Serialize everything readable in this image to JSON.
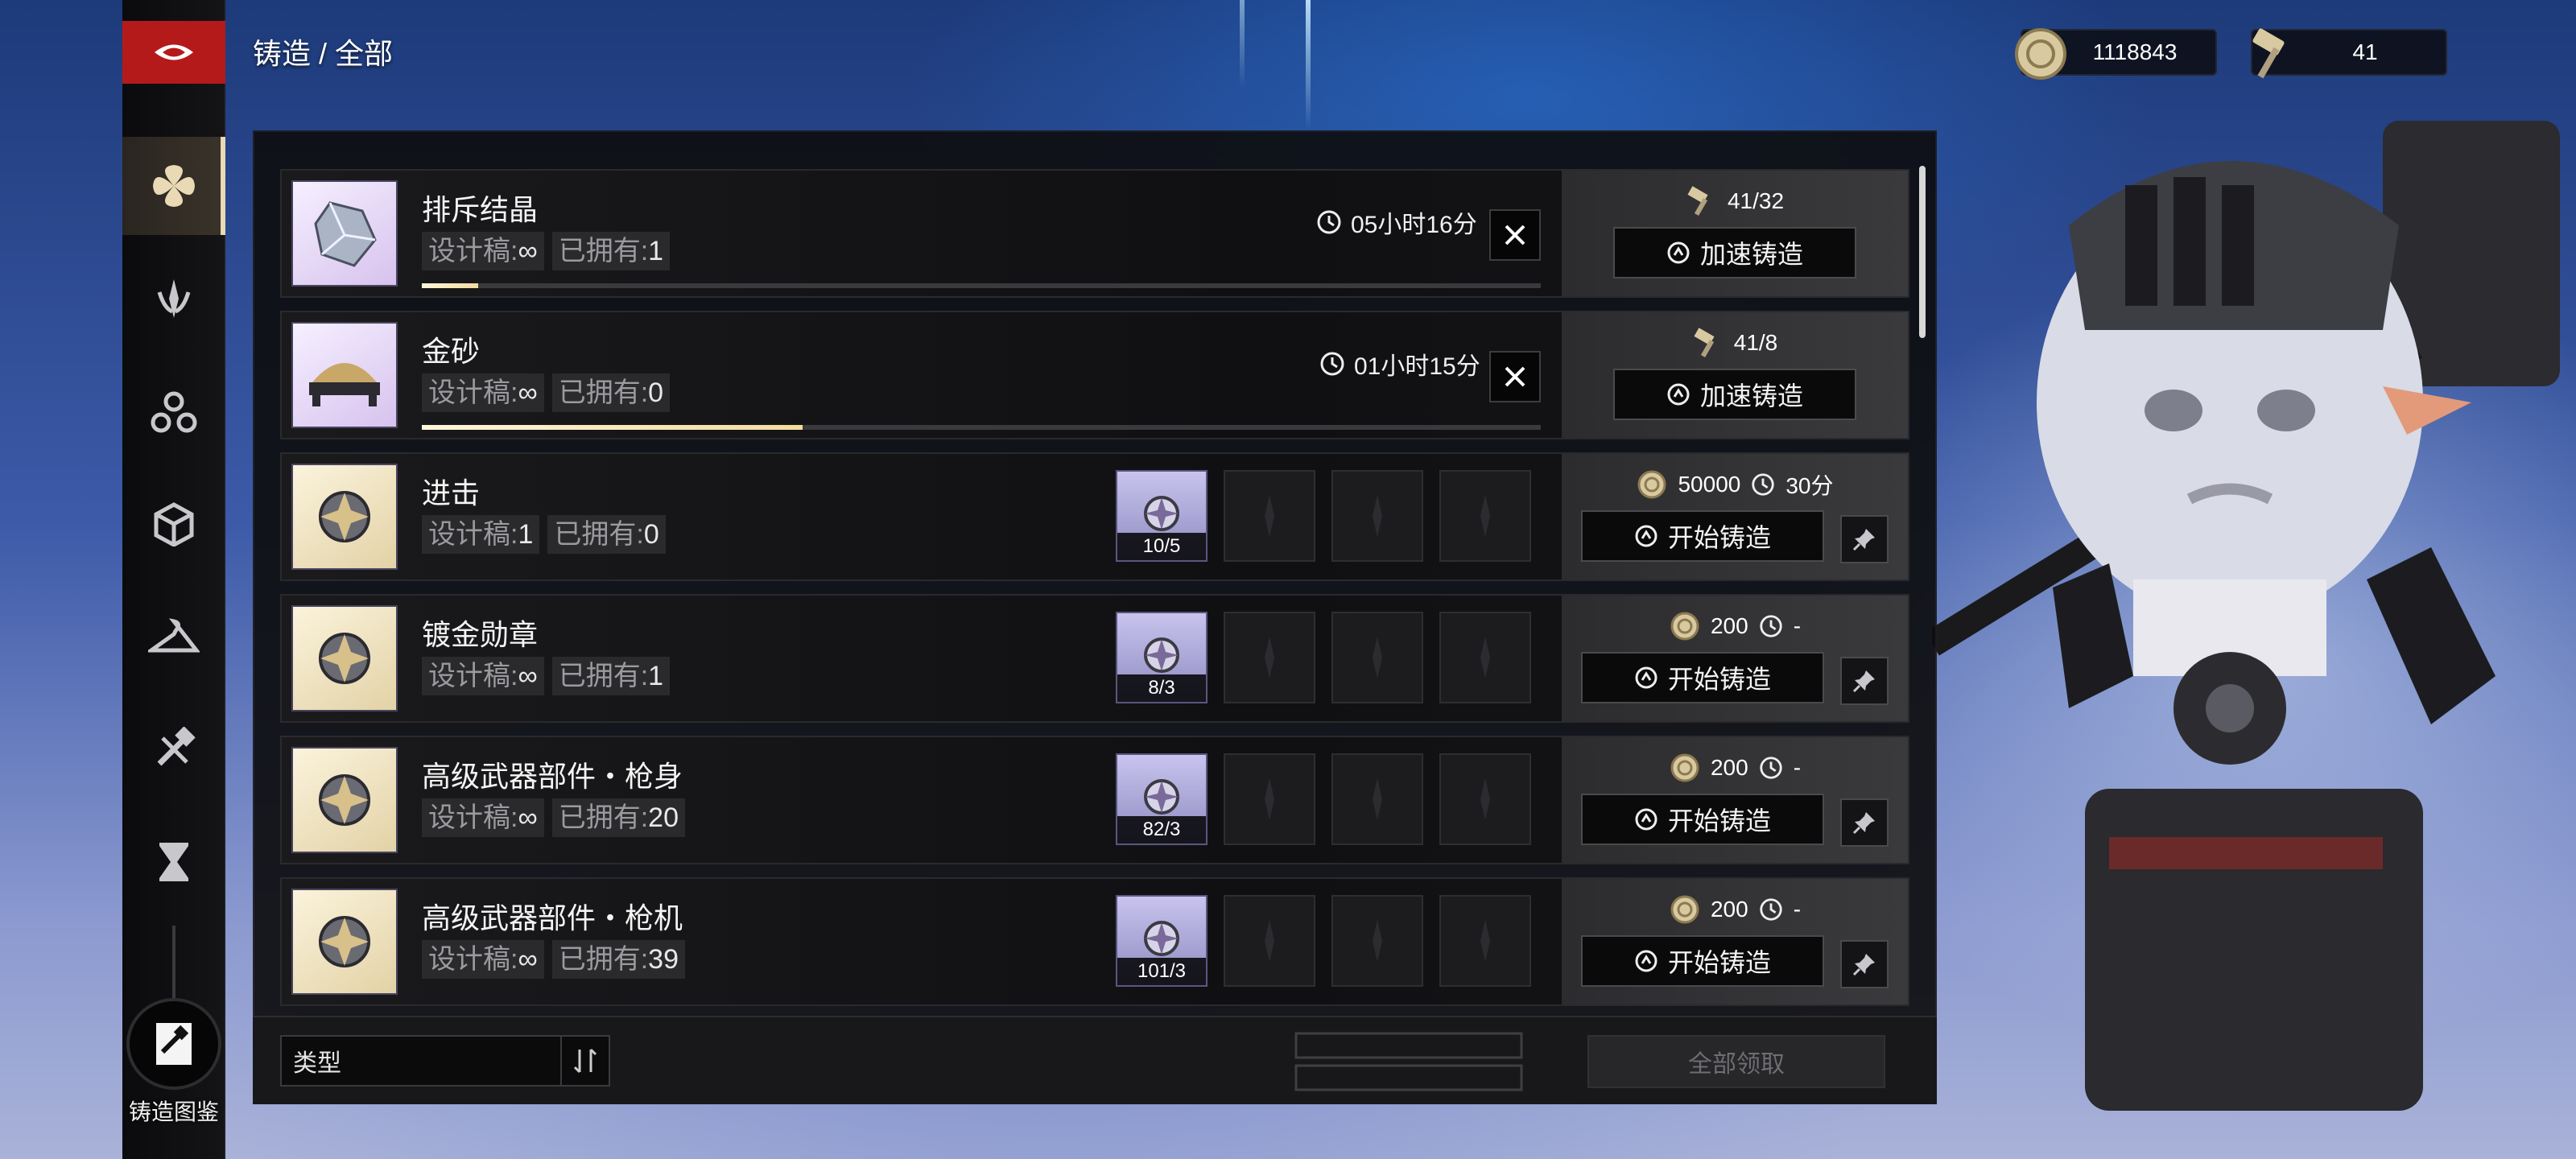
{
  "header": {
    "breadcrumb": "铸造 / 全部",
    "currencies": [
      {
        "icon": "coin-icon",
        "value": "1118843"
      },
      {
        "icon": "hammer-icon",
        "value": "41"
      }
    ]
  },
  "sidebar": {
    "items": [
      {
        "name": "nav-all",
        "icon": "flower-icon",
        "active": true
      },
      {
        "name": "nav-weapon",
        "icon": "blade-icon",
        "active": false
      },
      {
        "name": "nav-triangle",
        "icon": "triad-icon",
        "active": false
      },
      {
        "name": "nav-cube",
        "icon": "cube-icon",
        "active": false
      },
      {
        "name": "nav-hanger",
        "icon": "hanger-icon",
        "active": false
      },
      {
        "name": "nav-tools",
        "icon": "wrench-hammer-icon",
        "active": false
      },
      {
        "name": "nav-hourglass",
        "icon": "hourglass-icon",
        "active": false
      }
    ],
    "codex_label": "铸造图鉴"
  },
  "rows": [
    {
      "name": "排斥结晶",
      "design_label": "设计稿:",
      "design_value": "∞",
      "owned_label": "已拥有:",
      "owned_value": "1",
      "timer": "05小时16分",
      "progress": 0.05,
      "hammer_req": "41/32",
      "action": "加速铸造",
      "state": "forging"
    },
    {
      "name": "金砂",
      "design_label": "设计稿:",
      "design_value": "∞",
      "owned_label": "已拥有:",
      "owned_value": "0",
      "timer": "01小时15分",
      "progress": 0.34,
      "hammer_req": "41/8",
      "action": "加速铸造",
      "state": "forging"
    },
    {
      "name": "进击",
      "design_label": "设计稿:",
      "design_value": "1",
      "owned_label": "已拥有:",
      "owned_value": "0",
      "material_count": "10/5",
      "coin_cost": "50000",
      "time_cost": "30分",
      "action": "开始铸造",
      "state": "idle"
    },
    {
      "name": "镀金勋章",
      "design_label": "设计稿:",
      "design_value": "∞",
      "owned_label": "已拥有:",
      "owned_value": "1",
      "material_count": "8/3",
      "coin_cost": "200",
      "time_cost": "-",
      "action": "开始铸造",
      "state": "idle"
    },
    {
      "name": "高级武器部件・枪身",
      "design_label": "设计稿:",
      "design_value": "∞",
      "owned_label": "已拥有:",
      "owned_value": "20",
      "material_count": "82/3",
      "coin_cost": "200",
      "time_cost": "-",
      "action": "开始铸造",
      "state": "idle"
    },
    {
      "name": "高级武器部件・枪机",
      "design_label": "设计稿:",
      "design_value": "∞",
      "owned_label": "已拥有:",
      "owned_value": "39",
      "material_count": "101/3",
      "coin_cost": "200",
      "time_cost": "-",
      "action": "开始铸造",
      "state": "idle"
    }
  ],
  "footer": {
    "type_filter": "类型",
    "collect_all": "全部领取"
  },
  "colors": {
    "accent_red": "#b51a1a",
    "progress": "#f2dca0",
    "panel": "#0e0e10"
  }
}
